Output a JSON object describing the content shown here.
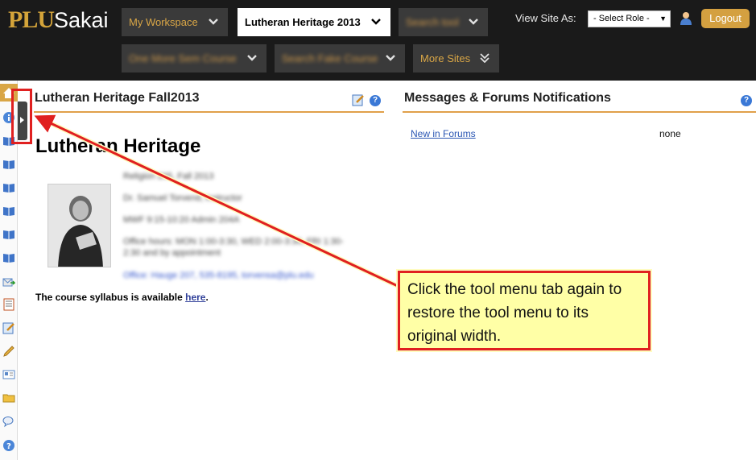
{
  "header": {
    "logo_plu": "PLU",
    "logo_sakai": "Sakai",
    "tabs": [
      {
        "label": "My Workspace",
        "active": false,
        "blurred": false
      },
      {
        "label": "Lutheran Heritage 2013",
        "active": true,
        "blurred": false
      },
      {
        "label": "Search tool",
        "active": false,
        "blurred": true
      },
      {
        "label": "One More Sem Course",
        "active": false,
        "blurred": true
      },
      {
        "label": "Search Fake Course",
        "active": false,
        "blurred": true
      },
      {
        "label": "More Sites",
        "active": false,
        "blurred": false
      }
    ],
    "view_site_as": "View Site As:",
    "role_select": "- Select Role -",
    "logout": "Logout"
  },
  "tool_menu": {
    "icons": [
      "home-icon",
      "info-icon",
      "book-icon",
      "book-icon",
      "book-icon",
      "book-icon",
      "book-icon",
      "book-icon",
      "mail-icon",
      "list-icon",
      "edit-icon",
      "pencil-icon",
      "card-icon",
      "folder-icon",
      "chat-icon",
      "help-icon"
    ]
  },
  "left_portlet": {
    "title": "Lutheran Heritage Fall2013",
    "heading": "Lutheran Heritage",
    "info_lines": [
      "Religion 265, Fall 2013",
      "Dr. Samuel Torvend, instructor",
      "MWF 9:15-10:20 Admin 204A",
      "Office hours: MON 1:00-3:30, WED 2:00-3:30, FRI 1:30-",
      "2:30 and by appointment",
      "Office: Hauge 207, 535-8195, torvensa@plu.edu"
    ],
    "syllabus_text": "The course syllabus is available",
    "syllabus_link": "here",
    "syllabus_end": "."
  },
  "right_portlet": {
    "title": "Messages & Forums Notifications",
    "forums_link": "New in Forums",
    "forums_value": "none"
  },
  "callout": {
    "text": "Click the tool menu tab again to restore the tool menu to its original width."
  },
  "colors": {
    "header_bg": "#1a1a1a",
    "accent_gold": "#d9a646",
    "callout_bg": "#ffffa6",
    "callout_border": "#e02020",
    "link_blue": "#2a56b3"
  }
}
